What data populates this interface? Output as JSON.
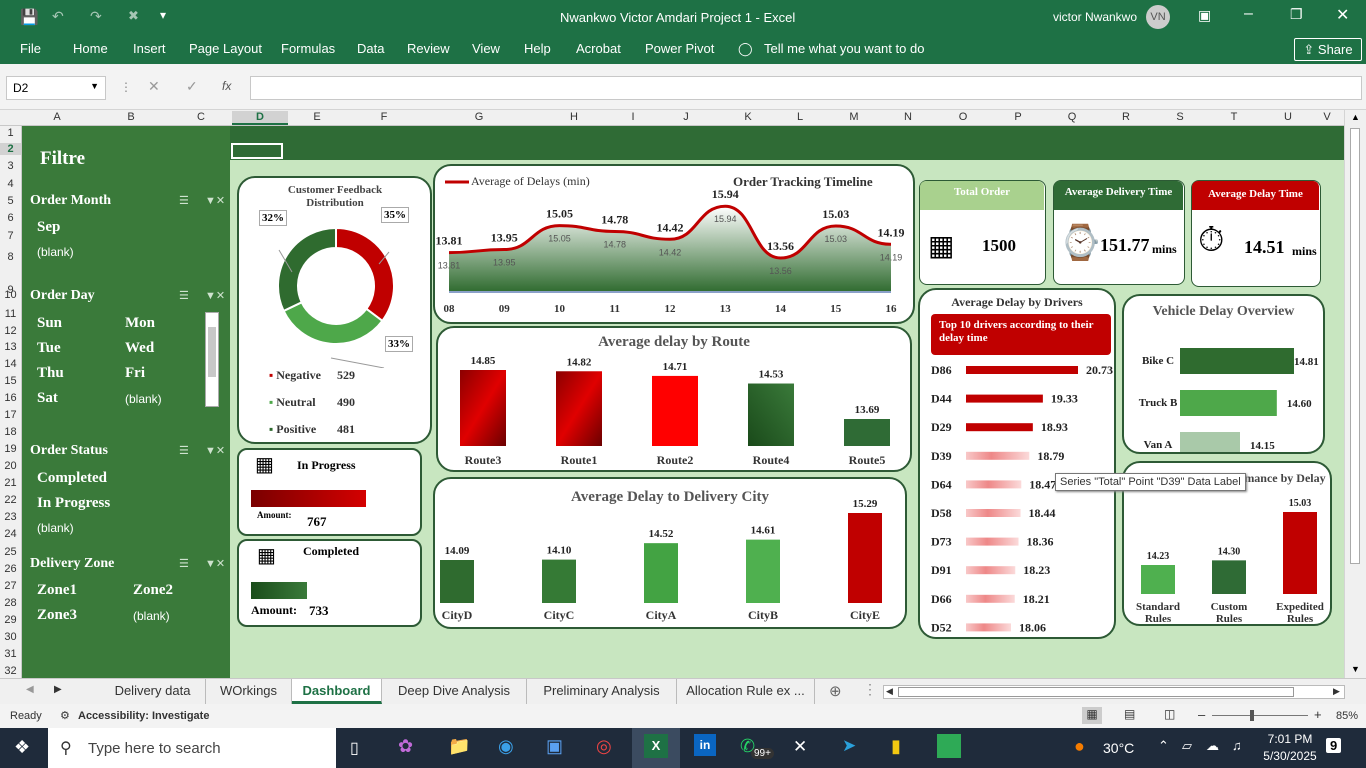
{
  "window": {
    "title": "Nwankwo Victor Amdari Project 1  -  Excel",
    "user": "victor Nwankwo",
    "user_initials": "VN"
  },
  "ribbon": {
    "tabs": [
      "File",
      "Home",
      "Insert",
      "Page Layout",
      "Formulas",
      "Data",
      "Review",
      "View",
      "Help",
      "Acrobat",
      "Power Pivot"
    ],
    "tell_me": "Tell me what you want to do",
    "share": "Share"
  },
  "formula_bar": {
    "name_box": "D2",
    "fx": "fx",
    "formula": ""
  },
  "columns": [
    "A",
    "B",
    "C",
    "D",
    "E",
    "F",
    "G",
    "H",
    "I",
    "J",
    "K",
    "L",
    "M",
    "N",
    "O",
    "P",
    "Q",
    "R",
    "S",
    "T",
    "U",
    "V"
  ],
  "rows": [
    "1",
    "2",
    "3",
    "4",
    "5",
    "6",
    "7",
    "8",
    "9",
    "10",
    "11",
    "12",
    "13",
    "14",
    "15",
    "16",
    "17",
    "18",
    "19",
    "20",
    "21",
    "22",
    "23",
    "24",
    "25",
    "26",
    "27",
    "28",
    "29",
    "30",
    "31",
    "32"
  ],
  "slicers": {
    "title": "Filtre",
    "order_month": {
      "header": "Order Month",
      "items": [
        "Sep",
        "(blank)"
      ]
    },
    "order_day": {
      "header": "Order Day",
      "items": [
        "Sun",
        "Mon",
        "Tue",
        "Wed",
        "Thu",
        "Fri",
        "Sat",
        "(blank)"
      ]
    },
    "order_status": {
      "header": "Order Status",
      "items": [
        "Completed",
        "In Progress",
        "(blank)"
      ]
    },
    "delivery_zone": {
      "header": "Delivery Zone",
      "items": [
        "Zone1",
        "Zone2",
        "Zone3",
        "(blank)"
      ]
    }
  },
  "feedback": {
    "title": "Customer Feedback Distribution",
    "slices": [
      {
        "label": "Negative",
        "value": 529,
        "pct": "35%",
        "color": "#c00000"
      },
      {
        "label": "Neutral",
        "value": 490,
        "pct": "33%",
        "color": "#4ea84a"
      },
      {
        "label": "Positive",
        "value": 481,
        "pct": "32%",
        "color": "#2f6b2f"
      }
    ]
  },
  "in_progress": {
    "title": "In Progress",
    "amount_label": "Amount:",
    "amount": "767"
  },
  "completed": {
    "title": "Completed",
    "amount_label": "Amount:",
    "amount": "733"
  },
  "timeline": {
    "title": "Order Tracking Timeline",
    "legend": "Average of Delays (min)"
  },
  "kpis": {
    "total_order": {
      "label": "Total Order",
      "value": "1500"
    },
    "avg_delivery": {
      "label": "Average Delivery Time",
      "value": "151.77",
      "unit": "mins"
    },
    "avg_delay": {
      "label": "Average Delay Time",
      "value": "14.51",
      "unit": "mins"
    }
  },
  "drivers": {
    "title": "Average Delay by Drivers",
    "banner": "Top 10 drivers according to their delay time"
  },
  "vehicle": {
    "title": "Vehicle Delay Overview"
  },
  "allocation": {
    "title": "Allocation Rule Performance by Delay"
  },
  "tooltip": "Series \"Total\" Point \"D39\" Data Label",
  "chart_data": [
    {
      "id": "timeline",
      "type": "area",
      "title": "Order Tracking Timeline",
      "series": [
        {
          "name": "Average of Delays (min)",
          "values": [
            13.81,
            13.95,
            15.05,
            14.78,
            14.42,
            15.94,
            13.56,
            15.03,
            14.19
          ]
        }
      ],
      "categories": [
        "08",
        "09",
        "10",
        "11",
        "12",
        "13",
        "14",
        "15",
        "16"
      ]
    },
    {
      "id": "route",
      "type": "bar",
      "title": "Average  delay by Route",
      "categories": [
        "Route3",
        "Route1",
        "Route2",
        "Route4",
        "Route5"
      ],
      "values": [
        14.85,
        14.82,
        14.71,
        14.53,
        13.69
      ]
    },
    {
      "id": "city",
      "type": "bar",
      "title": "Average Delay to Delivery City",
      "categories": [
        "CityD",
        "CityC",
        "CityA",
        "CityB",
        "CityE"
      ],
      "values": [
        14.09,
        14.1,
        14.52,
        14.61,
        15.29
      ]
    },
    {
      "id": "drivers",
      "type": "bar",
      "title": "Average Delay by Drivers",
      "categories": [
        "D86",
        "D44",
        "D29",
        "D39",
        "D64",
        "D58",
        "D73",
        "D91",
        "D66",
        "D52"
      ],
      "values": [
        20.73,
        19.33,
        18.93,
        18.79,
        18.47,
        18.44,
        18.36,
        18.23,
        18.21,
        18.06
      ]
    },
    {
      "id": "vehicle",
      "type": "bar",
      "title": "Vehicle Delay Overview",
      "categories": [
        "Bike C",
        "Truck B",
        "Van A"
      ],
      "values": [
        14.81,
        14.6,
        14.15
      ]
    },
    {
      "id": "allocation",
      "type": "bar",
      "title": "Allocation Rule Performance by Delay",
      "categories": [
        "Standard Rules",
        "Custom Rules",
        "Expedited Rules"
      ],
      "values": [
        14.23,
        14.3,
        15.03
      ]
    }
  ],
  "sheet_tabs": [
    "Delivery data",
    "WOrkings",
    "Dashboard",
    "Deep Dive Analysis",
    "Preliminary Analysis",
    "Allocation Rule ex ..."
  ],
  "active_tab": "Dashboard",
  "status": {
    "ready": "Ready",
    "accessibility": "Accessibility: Investigate",
    "zoom": "85%"
  },
  "taskbar": {
    "search": "Type here to search",
    "weather": "30°C",
    "time": "7:01 PM",
    "date": "5/30/2025",
    "notifications": "9",
    "whatsapp_badge": "99+"
  }
}
